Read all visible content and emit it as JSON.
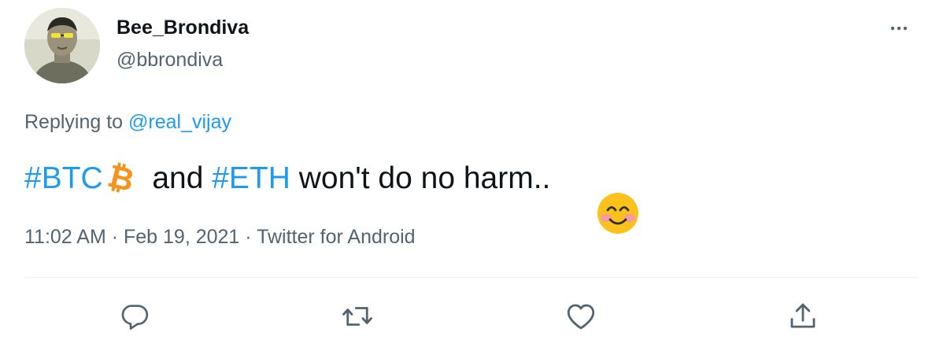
{
  "user": {
    "display_name": "Bee_Brondiva",
    "handle": "@bbrondiva"
  },
  "reply": {
    "prefix": "Replying to ",
    "mention": "@real_vijay"
  },
  "tweet": {
    "hashtag1": "#BTC",
    "btc_symbol": "₿",
    "text_mid": "and ",
    "hashtag2": "#ETH",
    "text_end": " won't do no harm..",
    "emoji": "smiling-face-with-smiling-eyes"
  },
  "meta": {
    "time": "11:02 AM",
    "separator": " · ",
    "date": "Feb 19, 2021",
    "source": "Twitter for Android"
  },
  "icons": {
    "more": "more-dots-icon",
    "reply": "reply-bubble-icon",
    "retweet": "retweet-icon",
    "like": "heart-icon",
    "share": "share-icon"
  },
  "colors": {
    "accent": "#1d9bf0",
    "secondary_text": "#536471",
    "primary_text": "#0f1419",
    "btc": "#f7931a"
  }
}
